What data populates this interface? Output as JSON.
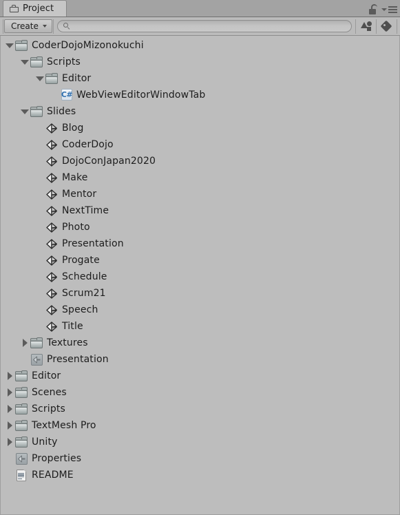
{
  "window": {
    "tab": {
      "label": "Project",
      "icon": "project-folder-icon"
    },
    "header_right": {
      "lock_icon": "lock-open-icon",
      "menu_icon": "hamburger-menu-icon"
    }
  },
  "toolbar": {
    "create_label": "Create",
    "create_caret": "chevron-down-icon",
    "search": {
      "value": "",
      "placeholder": "",
      "icon": "search-icon"
    },
    "filters": [
      {
        "name": "filter-by-type-button",
        "icon": "shapes-icon"
      },
      {
        "name": "filter-by-label-button",
        "icon": "tag-icon"
      }
    ]
  },
  "tree": {
    "rows": [
      {
        "label": "CoderDojoMizonokuchi",
        "indent": 0,
        "twisty": "down",
        "icon": "folder"
      },
      {
        "label": "Scripts",
        "indent": 1,
        "twisty": "down",
        "icon": "folder"
      },
      {
        "label": "Editor",
        "indent": 2,
        "twisty": "down",
        "icon": "folder"
      },
      {
        "label": "WebViewEditorWindowTab",
        "indent": 3,
        "twisty": "none",
        "icon": "csharp"
      },
      {
        "label": "Slides",
        "indent": 1,
        "twisty": "down",
        "icon": "folder"
      },
      {
        "label": "Blog",
        "indent": 2,
        "twisty": "none",
        "icon": "prefab"
      },
      {
        "label": "CoderDojo",
        "indent": 2,
        "twisty": "none",
        "icon": "prefab"
      },
      {
        "label": "DojoConJapan2020",
        "indent": 2,
        "twisty": "none",
        "icon": "prefab"
      },
      {
        "label": "Make",
        "indent": 2,
        "twisty": "none",
        "icon": "prefab"
      },
      {
        "label": "Mentor",
        "indent": 2,
        "twisty": "none",
        "icon": "prefab"
      },
      {
        "label": "NextTime",
        "indent": 2,
        "twisty": "none",
        "icon": "prefab"
      },
      {
        "label": "Photo",
        "indent": 2,
        "twisty": "none",
        "icon": "prefab"
      },
      {
        "label": "Presentation",
        "indent": 2,
        "twisty": "none",
        "icon": "prefab"
      },
      {
        "label": "Progate",
        "indent": 2,
        "twisty": "none",
        "icon": "prefab"
      },
      {
        "label": "Schedule",
        "indent": 2,
        "twisty": "none",
        "icon": "prefab"
      },
      {
        "label": "Scrum21",
        "indent": 2,
        "twisty": "none",
        "icon": "prefab"
      },
      {
        "label": "Speech",
        "indent": 2,
        "twisty": "none",
        "icon": "prefab"
      },
      {
        "label": "Title",
        "indent": 2,
        "twisty": "none",
        "icon": "prefab"
      },
      {
        "label": "Textures",
        "indent": 1,
        "twisty": "right",
        "icon": "folder"
      },
      {
        "label": "Presentation",
        "indent": 1,
        "twisty": "none",
        "icon": "asset"
      },
      {
        "label": "Editor",
        "indent": 0,
        "twisty": "right",
        "icon": "folder"
      },
      {
        "label": "Scenes",
        "indent": 0,
        "twisty": "right",
        "icon": "folder"
      },
      {
        "label": "Scripts",
        "indent": 0,
        "twisty": "right",
        "icon": "folder"
      },
      {
        "label": "TextMesh Pro",
        "indent": 0,
        "twisty": "right",
        "icon": "folder"
      },
      {
        "label": "Unity",
        "indent": 0,
        "twisty": "right",
        "icon": "folder"
      },
      {
        "label": "Properties",
        "indent": 0,
        "twisty": "none",
        "icon": "asset"
      },
      {
        "label": "README",
        "indent": 0,
        "twisty": "none",
        "icon": "doc"
      }
    ]
  },
  "colors": {
    "window_background": "#bdbdbd",
    "tabstrip_background": "#a3a3a3",
    "toolbar_background": "#bbbbbb",
    "tab_active_background": "#c6c6c6",
    "text": "#1c1c1c",
    "twisty": "#5c5c5c",
    "csharp_accent": "#2f6fae"
  }
}
